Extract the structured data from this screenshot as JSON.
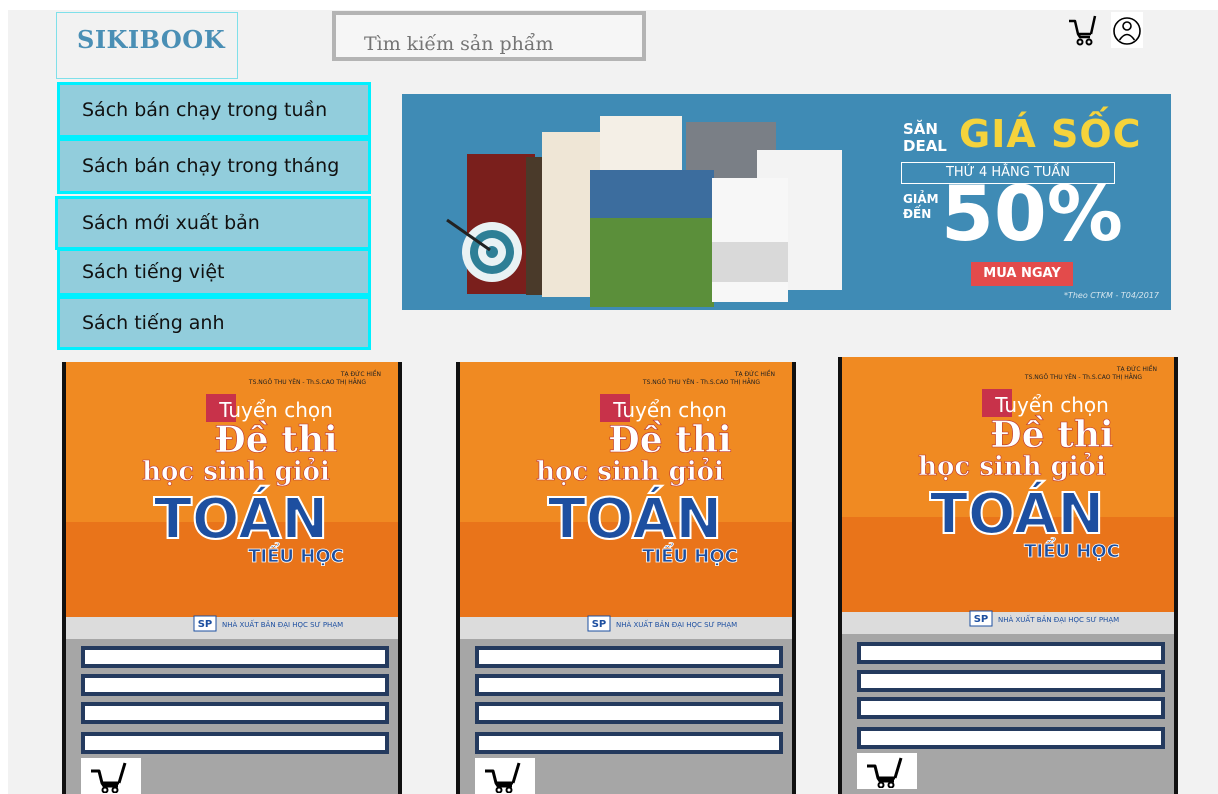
{
  "header": {
    "logo": "SIKIBOOK",
    "search_placeholder": "Tìm kiếm sản phẩm",
    "icons": [
      "cart-icon",
      "user-icon"
    ]
  },
  "menu": {
    "items": [
      {
        "label": "Sách bán chạy trong tuần"
      },
      {
        "label": "Sách bán chạy trong tháng"
      },
      {
        "label": "Sách mới xuất bản"
      },
      {
        "label": "Sách tiếng việt"
      },
      {
        "label": "Sách tiếng anh"
      }
    ]
  },
  "banner": {
    "headline_top": "SĂN",
    "headline_sub": "DEAL",
    "headline_main": "GIÁ SỐC",
    "schedule": "THỨ 4 HẰNG TUẦN",
    "discount_prefix_1": "GIẢM",
    "discount_prefix_2": "ĐẾN",
    "discount": "50%",
    "cta": "MUA NGAY",
    "fine_print": "*Theo CTKM - T04/2017"
  },
  "product_cover": {
    "authors_1": "TẠ ĐỨC HIỀN",
    "authors_2": "TS.NGÔ THU YÊN - Th.S.CAO THỊ HẰNG",
    "title_1": "Tuyển chọn",
    "title_2": "Đề thi",
    "title_3": "học sinh giỏi",
    "title_4": "TOÁN",
    "title_5": "TIỂU HỌC",
    "publisher": "NHÀ XUẤT BẢN ĐẠI HỌC SƯ PHẠM",
    "publisher_logo": "SP"
  },
  "colors": {
    "menu_bg": "#92cddc",
    "menu_border": "#00f0ff",
    "banner_bg": "#3f8bb5",
    "promo_yellow": "#f5d33c",
    "cta_red": "#e34b4b",
    "field_border": "#243a5e",
    "card_bg": "#a6a6a6"
  }
}
